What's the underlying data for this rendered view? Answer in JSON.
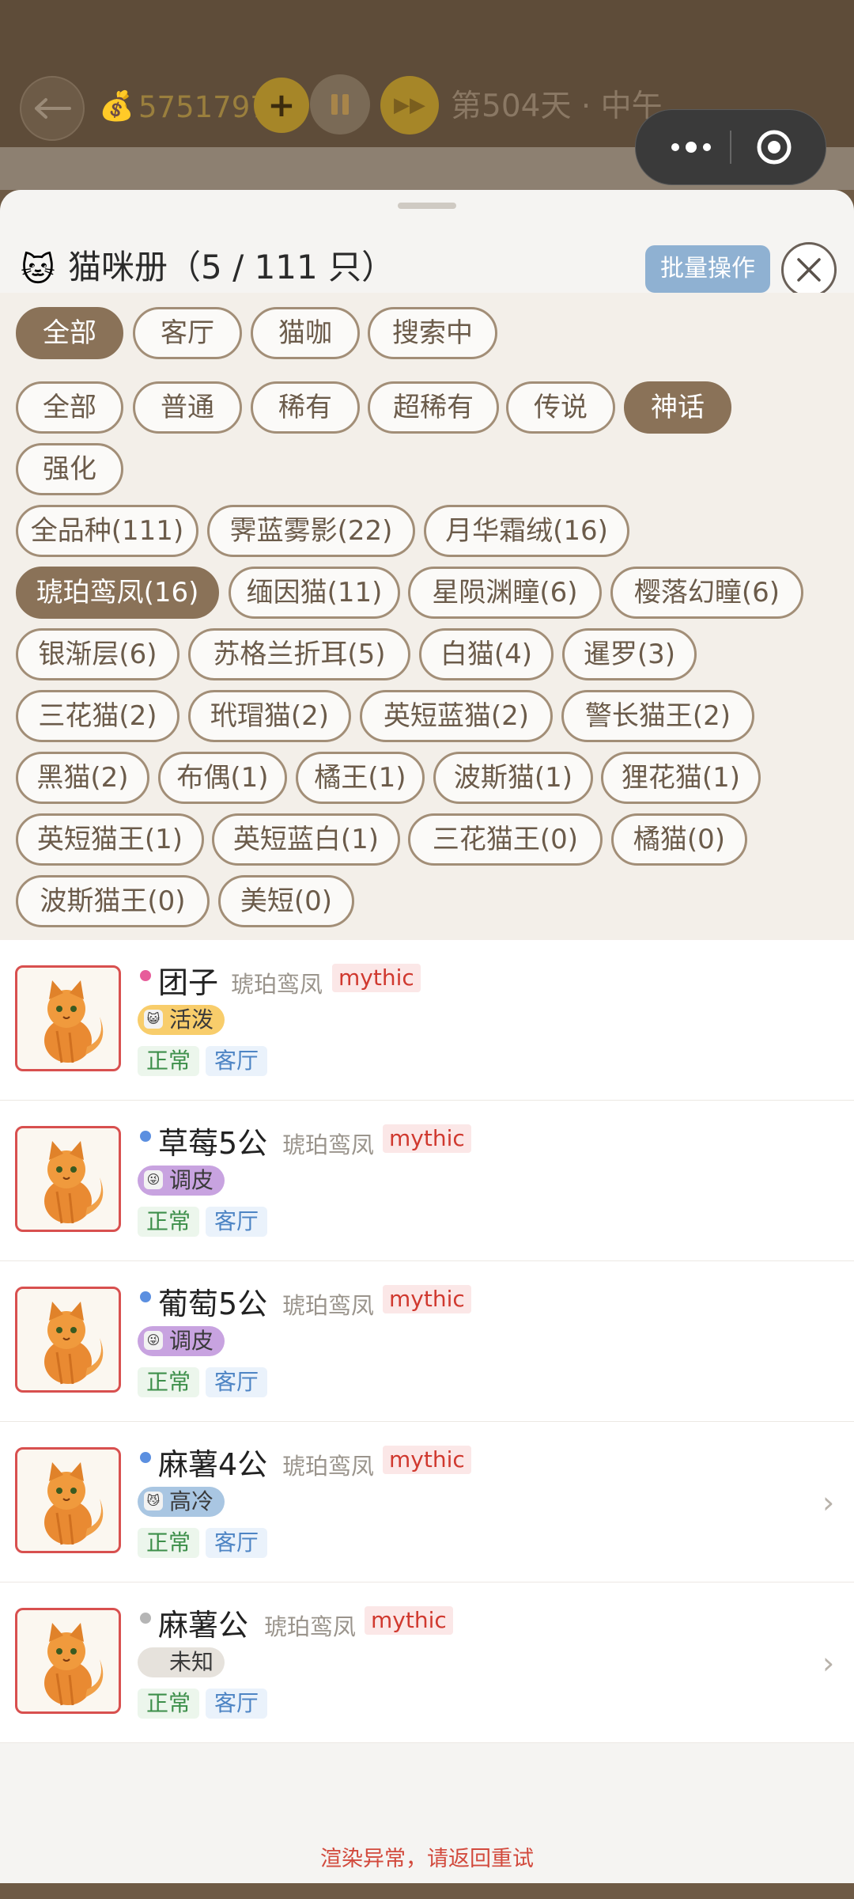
{
  "topbar": {
    "coins": "5751797",
    "plus_label": "+",
    "ff_label": "▶▶",
    "day_label": "第504天 · 中午"
  },
  "header": {
    "icon": "🐱",
    "title": "猫咪册（5 / 111 只）",
    "batch_label": "批量操作"
  },
  "filters": {
    "location": [
      "全部",
      "客厅",
      "猫咖",
      "搜索中"
    ],
    "rarity": [
      "全部",
      "普通",
      "稀有",
      "超稀有",
      "传说",
      "神话",
      "强化"
    ],
    "breeds": [
      "全品种(111)",
      "霁蓝雾影(22)",
      "月华霜绒(16)",
      "琥珀鸾凤(16)",
      "缅因猫(11)",
      "星陨渊瞳(6)",
      "樱落幻瞳(6)",
      "银渐层(6)",
      "苏格兰折耳(5)",
      "白猫(4)",
      "暹罗(3)",
      "三花猫(2)",
      "玳瑁猫(2)",
      "英短蓝猫(2)",
      "警长猫王(2)",
      "黑猫(2)",
      "布偶(1)",
      "橘王(1)",
      "波斯猫(1)",
      "狸花猫(1)",
      "英短猫王(1)",
      "英短蓝白(1)",
      "三花猫王(0)",
      "橘猫(0)",
      "波斯猫王(0)",
      "美短(0)"
    ]
  },
  "cats": [
    {
      "name": "团子",
      "breed": "琥珀鸾凤",
      "rarity": "mythic",
      "mood": "活泼",
      "status": "正常",
      "location": "客厅"
    },
    {
      "name": "草莓5公",
      "breed": "琥珀鸾凤",
      "rarity": "mythic",
      "mood": "调皮",
      "status": "正常",
      "location": "客厅"
    },
    {
      "name": "葡萄5公",
      "breed": "琥珀鸾凤",
      "rarity": "mythic",
      "mood": "调皮",
      "status": "正常",
      "location": "客厅"
    },
    {
      "name": "麻薯4公",
      "breed": "琥珀鸾凤",
      "rarity": "mythic",
      "mood": "高冷",
      "status": "正常",
      "location": "客厅"
    },
    {
      "name": "麻薯公",
      "breed": "琥珀鸾凤",
      "rarity": "mythic",
      "mood": "未知",
      "status": "正常",
      "location": "客厅"
    }
  ],
  "footer": {
    "error": "渲染异常，请返回重试"
  },
  "colors": {
    "accent_brown": "#8a7258",
    "mythic_red": "#d0392f",
    "batch_blue": "#8fb1d2"
  }
}
